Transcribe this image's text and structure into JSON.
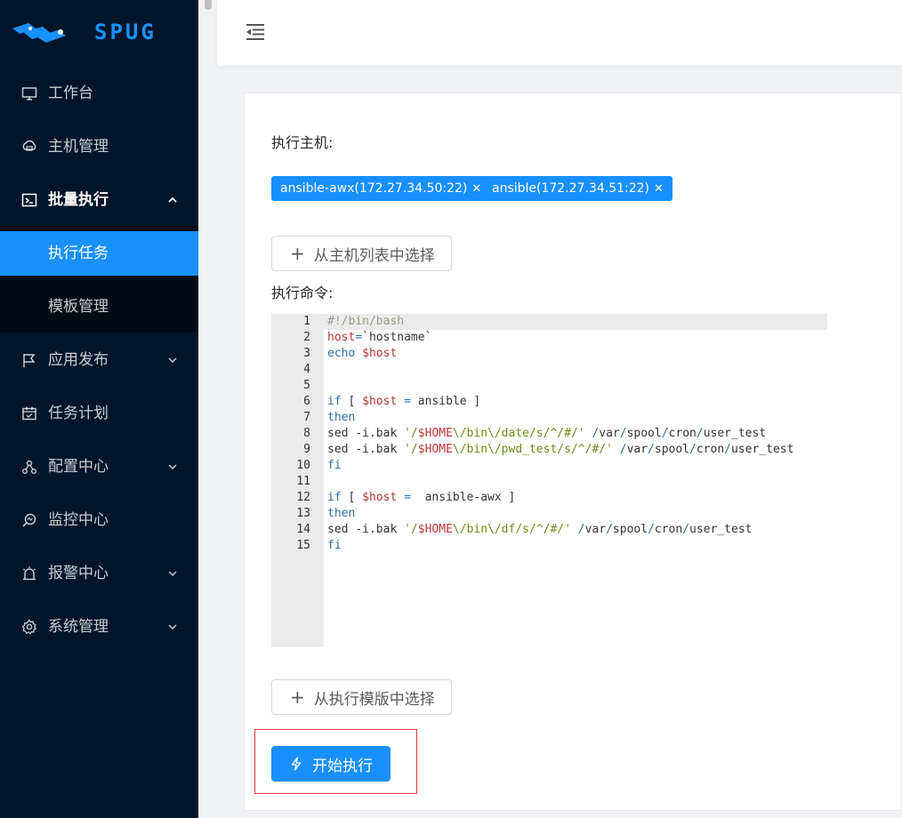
{
  "app": {
    "logo_text": "SPUG",
    "accent": "#1890ff",
    "sidebar_bg": "#001529"
  },
  "sidebar": {
    "items": [
      {
        "label": "工作台",
        "icon": "desktop-icon"
      },
      {
        "label": "主机管理",
        "icon": "cloud-server-icon"
      },
      {
        "label": "批量执行",
        "icon": "terminal-icon",
        "expanded": true,
        "children": [
          {
            "label": "执行任务",
            "selected": true
          },
          {
            "label": "模板管理"
          }
        ]
      },
      {
        "label": "应用发布",
        "icon": "flag-icon"
      },
      {
        "label": "任务计划",
        "icon": "calendar-icon"
      },
      {
        "label": "配置中心",
        "icon": "deployment-unit-icon"
      },
      {
        "label": "监控中心",
        "icon": "monitor-search-icon"
      },
      {
        "label": "报警中心",
        "icon": "alert-icon"
      },
      {
        "label": "系统管理",
        "icon": "setting-icon"
      }
    ]
  },
  "main": {
    "hosts_label": "执行主机:",
    "hosts": [
      {
        "label": "ansible-awx(172.27.34.50:22)"
      },
      {
        "label": "ansible(172.27.34.51:22)"
      }
    ],
    "select_host_button": "从主机列表中选择",
    "command_label": "执行命令:",
    "code_lines": [
      "#!/bin/bash",
      "host=`hostname`",
      "echo $host",
      "",
      "",
      "if [ $host = ansible ]",
      "then",
      "sed -i.bak '/$HOME\\/bin\\/date/s/^/#/' /var/spool/cron/user_test",
      "sed -i.bak '/$HOME\\/bin\\/pwd_test/s/^/#/' /var/spool/cron/user_test",
      "fi",
      "",
      "if [ $host =  ansible-awx ]",
      "then",
      "sed -i.bak '/$HOME\\/bin\\/df/s/^/#/' /var/spool/cron/user_test",
      "fi"
    ],
    "line_numbers": [
      "1",
      "2",
      "3",
      "4",
      "5",
      "6",
      "7",
      "8",
      "9",
      "10",
      "11",
      "12",
      "13",
      "14",
      "15"
    ],
    "select_template_button": "从执行模版中选择",
    "start_button": "开始执行"
  }
}
